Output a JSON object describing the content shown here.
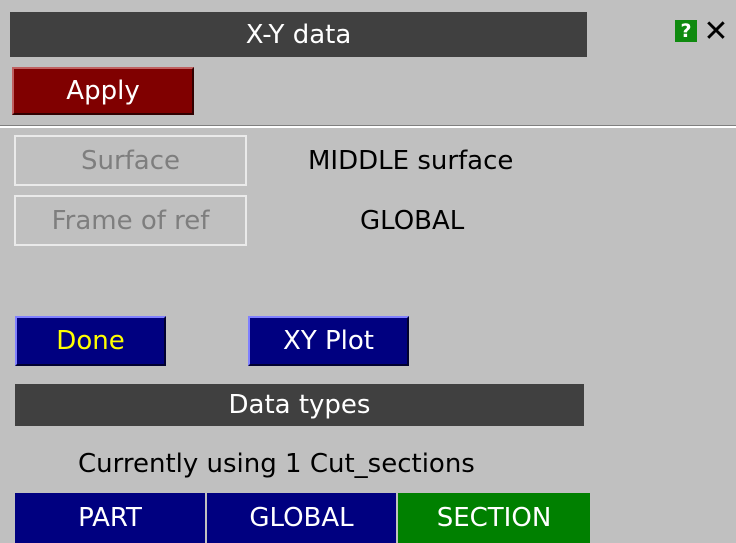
{
  "window": {
    "title": "X-Y data",
    "help_label": "?",
    "close_label": "✕"
  },
  "toolbar": {
    "apply_label": "Apply"
  },
  "settings": {
    "surface_button_label": "Surface",
    "surface_value": "MIDDLE surface",
    "frame_button_label": "Frame of ref",
    "frame_value": "GLOBAL"
  },
  "actions": {
    "done_label": "Done",
    "xyplot_label": "XY Plot"
  },
  "data_types": {
    "header": "Data types",
    "status": "Currently using 1 Cut_sections",
    "tabs": [
      {
        "label": "PART",
        "selected": false
      },
      {
        "label": "GLOBAL",
        "selected": false
      },
      {
        "label": "SECTION",
        "selected": true
      }
    ]
  },
  "colors": {
    "background": "#c0c0c0",
    "header": "#404040",
    "apply": "#800000",
    "button_blue": "#000080",
    "selected_tab": "#008000",
    "done_text": "#ffff00"
  }
}
